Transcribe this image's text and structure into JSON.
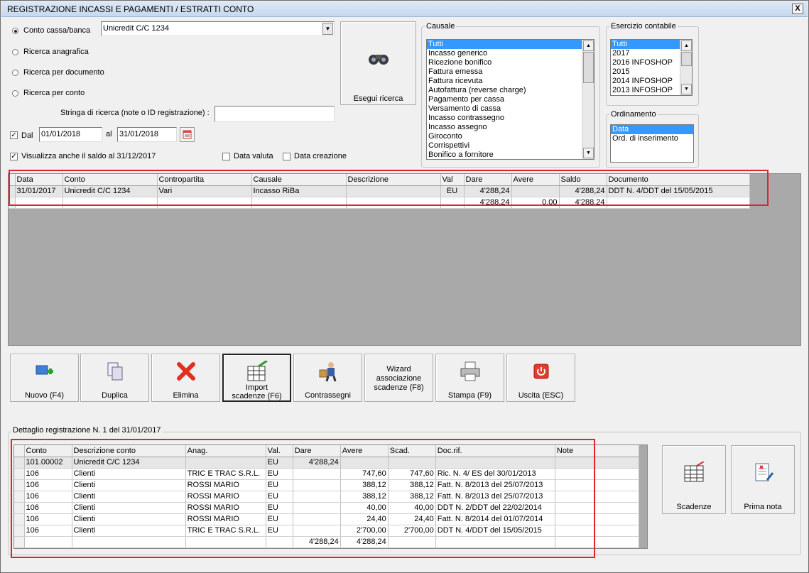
{
  "window": {
    "title": "REGISTRAZIONE INCASSI E PAGAMENTI / ESTRATTI CONTO",
    "close": "X"
  },
  "search": {
    "mode_options": [
      "Conto cassa/banca",
      "Ricerca anagrafica",
      "Ricerca per documento",
      "Ricerca per conto"
    ],
    "selected_mode": "Conto cassa/banca",
    "account_value": "Unicredit C/C 1234",
    "search_string_label": "Stringa di ricerca (note o ID registrazione) :",
    "search_string_value": "",
    "date_from_label": "Dal",
    "date_from_checked": true,
    "date_from": "01/01/2018",
    "date_to_label": "al",
    "date_to": "31/01/2018",
    "show_balance_label": "Visualizza anche il saldo al 31/12/2017",
    "show_balance_checked": true,
    "value_date_label": "Data valuta",
    "value_date_checked": false,
    "creation_date_label": "Data creazione",
    "creation_date_checked": false,
    "search_button": "Esegui ricerca"
  },
  "causale": {
    "title": "Causale",
    "items": [
      "Tutti",
      "Incasso generico",
      "Ricezione bonifico",
      "Fattura emessa",
      "Fattura ricevuta",
      "Autofattura (reverse charge)",
      "Pagamento per cassa",
      "Versamento di cassa",
      "Incasso contrassegno",
      "Incasso assegno",
      "Giroconto",
      "Corrispettivi",
      "Bonifico a fornitore"
    ],
    "selected": "Tutti"
  },
  "esercizio": {
    "title": "Esercizio contabile",
    "items": [
      "Tutti",
      "2017",
      "2016 INFOSHOP",
      "2015",
      "2014 INFOSHOP",
      "2013 INFOSHOP"
    ],
    "selected": "Tutti"
  },
  "ordinamento": {
    "title": "Ordinamento",
    "items": [
      "Data",
      "Ord. di inserimento"
    ],
    "selected": "Data"
  },
  "main_grid": {
    "columns": [
      "Data",
      "Conto",
      "Contropartita",
      "Causale",
      "Descrizione",
      "Val",
      "Dare",
      "Avere",
      "Saldo",
      "Documento"
    ],
    "rows": [
      [
        "31/01/2017",
        "Unicredit C/C 1234",
        "Vari",
        "Incasso RiBa",
        "",
        "EU",
        "4'288,24",
        "",
        "4'288,24",
        "DDT N. 4/DDT del 15/05/2015"
      ]
    ],
    "totals": [
      "",
      "",
      "",
      "",
      "",
      "",
      "4'288,24",
      "0,00",
      "4'288,24",
      ""
    ]
  },
  "toolbar": {
    "buttons": [
      {
        "label": "Nuovo (F4)",
        "icon": "new-icon"
      },
      {
        "label": "Duplica",
        "icon": "duplicate-icon"
      },
      {
        "label": "Elimina",
        "icon": "delete-icon"
      },
      {
        "label": "Import scadenze (F6)",
        "icon": "import-icon"
      },
      {
        "label": "Contrassegni",
        "icon": "courier-icon"
      },
      {
        "label": "Wizard associazione scadenze (F8)",
        "icon": ""
      },
      {
        "label": "Stampa (F9)",
        "icon": "printer-icon"
      },
      {
        "label": "Uscita (ESC)",
        "icon": "exit-icon"
      }
    ]
  },
  "detail": {
    "title": "Dettaglio registrazione N. 1 del 31/01/2017",
    "columns": [
      "Conto",
      "Descrizione conto",
      "Anag.",
      "Val.",
      "Dare",
      "Avere",
      "Scad.",
      "Doc.rif.",
      "Note"
    ],
    "rows": [
      [
        "101.00002",
        "Unicredit C/C 1234",
        "",
        "EU",
        "4'288,24",
        "",
        "",
        "",
        ""
      ],
      [
        "106",
        "Clienti",
        "TRIC E TRAC S.R.L.",
        "EU",
        "",
        "747,60",
        "747,60",
        "Ric. N. 4/ ES del 30/01/2013",
        ""
      ],
      [
        "106",
        "Clienti",
        "ROSSI MARIO",
        "EU",
        "",
        "388,12",
        "388,12",
        "Fatt. N. 8/2013 del 25/07/2013",
        ""
      ],
      [
        "106",
        "Clienti",
        "ROSSI MARIO",
        "EU",
        "",
        "388,12",
        "388,12",
        "Fatt. N. 8/2013 del 25/07/2013",
        ""
      ],
      [
        "106",
        "Clienti",
        "ROSSI MARIO",
        "EU",
        "",
        "40,00",
        "40,00",
        "DDT N. 2/DDT del 22/02/2014",
        ""
      ],
      [
        "106",
        "Clienti",
        "ROSSI MARIO",
        "EU",
        "",
        "24,40",
        "24,40",
        "Fatt. N. 8/2014 del 01/07/2014",
        ""
      ],
      [
        "106",
        "Clienti",
        "TRIC E TRAC S.R.L.",
        "EU",
        "",
        "2'700,00",
        "2'700,00",
        "DDT N. 4/DDT del 15/05/2015",
        ""
      ]
    ],
    "totals": [
      "",
      "",
      "",
      "",
      "4'288,24",
      "4'288,24",
      "",
      "",
      ""
    ],
    "side_buttons": [
      {
        "label": "Scadenze",
        "icon": "grid-icon"
      },
      {
        "label": "Prima nota",
        "icon": "note-icon"
      }
    ]
  },
  "colors": {
    "highlight": "#e0242a",
    "selection": "#3399ff"
  }
}
